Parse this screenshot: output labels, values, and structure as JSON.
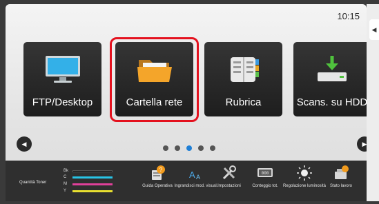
{
  "header": {
    "clock": "10:15"
  },
  "tiles": [
    {
      "label": "FTP/Desktop",
      "icon": "monitor-icon"
    },
    {
      "label": "Cartella rete",
      "icon": "folder-icon",
      "selected": true
    },
    {
      "label": "Rubrica",
      "icon": "address-book-icon"
    },
    {
      "label": "Scans. su HDD",
      "icon": "hdd-download-icon"
    }
  ],
  "pager": {
    "pages": 5,
    "active_page": 3
  },
  "toner": {
    "title": "Quantità Toner",
    "levels": [
      {
        "label": "Bk",
        "color": "#111111"
      },
      {
        "label": "C",
        "color": "#28c4e6"
      },
      {
        "label": "M",
        "color": "#e0409a"
      },
      {
        "label": "Y",
        "color": "#e8e030"
      }
    ]
  },
  "toolbar": {
    "items": [
      {
        "label": "Guida Operativa",
        "icon": "help-guide-icon"
      },
      {
        "label": "Ingrandisci mod. visual.",
        "icon": "zoom-text-icon"
      },
      {
        "label": "Impostazioni",
        "icon": "settings-tools-icon"
      },
      {
        "label": "Conteggio tot.",
        "icon": "counter-icon"
      },
      {
        "label": "Regolazione luminosità",
        "icon": "brightness-icon"
      },
      {
        "label": "Stato lavoro",
        "icon": "job-status-icon"
      }
    ]
  },
  "colors": {
    "accent": "#1f7fd6",
    "selection": "#e4111e"
  }
}
